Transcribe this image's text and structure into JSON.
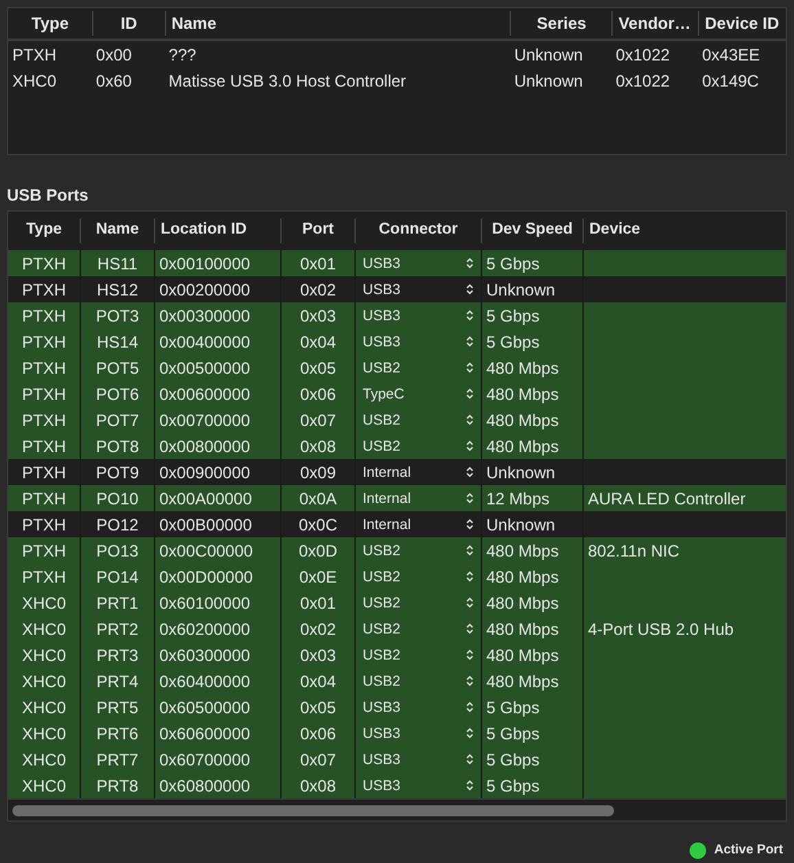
{
  "controllers": {
    "columns": [
      "Type",
      "ID",
      "Name",
      "Series",
      "Vendor…",
      "Device ID"
    ],
    "rows": [
      [
        "PTXH",
        "0x00",
        "???",
        "Unknown",
        "0x1022",
        "0x43EE"
      ],
      [
        "XHC0",
        "0x60",
        "Matisse USB 3.0 Host Controller",
        "Unknown",
        "0x1022",
        "0x149C"
      ]
    ]
  },
  "usb_ports": {
    "title": "USB Ports",
    "columns": [
      "Type",
      "Name",
      "Location ID",
      "Port",
      "Connector",
      "Dev Speed",
      "Device"
    ],
    "rows": [
      {
        "type": "PTXH",
        "name": "HS11",
        "location": "0x00100000",
        "port": "0x01",
        "connector": "USB3",
        "speed": "5 Gbps",
        "device": "",
        "active": true
      },
      {
        "type": "PTXH",
        "name": "HS12",
        "location": "0x00200000",
        "port": "0x02",
        "connector": "USB3",
        "speed": "Unknown",
        "device": "",
        "active": false
      },
      {
        "type": "PTXH",
        "name": "POT3",
        "location": "0x00300000",
        "port": "0x03",
        "connector": "USB3",
        "speed": "5 Gbps",
        "device": "",
        "active": true
      },
      {
        "type": "PTXH",
        "name": "HS14",
        "location": "0x00400000",
        "port": "0x04",
        "connector": "USB3",
        "speed": "5 Gbps",
        "device": "",
        "active": true
      },
      {
        "type": "PTXH",
        "name": "POT5",
        "location": "0x00500000",
        "port": "0x05",
        "connector": "USB2",
        "speed": "480 Mbps",
        "device": "",
        "active": true
      },
      {
        "type": "PTXH",
        "name": "POT6",
        "location": "0x00600000",
        "port": "0x06",
        "connector": "TypeC",
        "speed": "480 Mbps",
        "device": "",
        "active": true
      },
      {
        "type": "PTXH",
        "name": "POT7",
        "location": "0x00700000",
        "port": "0x07",
        "connector": "USB2",
        "speed": "480 Mbps",
        "device": "",
        "active": true
      },
      {
        "type": "PTXH",
        "name": "POT8",
        "location": "0x00800000",
        "port": "0x08",
        "connector": "USB2",
        "speed": "480 Mbps",
        "device": "",
        "active": true
      },
      {
        "type": "PTXH",
        "name": "POT9",
        "location": "0x00900000",
        "port": "0x09",
        "connector": "Internal",
        "speed": "Unknown",
        "device": "",
        "active": false
      },
      {
        "type": "PTXH",
        "name": "PO10",
        "location": "0x00A00000",
        "port": "0x0A",
        "connector": "Internal",
        "speed": "12 Mbps",
        "device": "AURA LED Controller",
        "active": true
      },
      {
        "type": "PTXH",
        "name": "PO12",
        "location": "0x00B00000",
        "port": "0x0C",
        "connector": "Internal",
        "speed": "Unknown",
        "device": "",
        "active": false
      },
      {
        "type": "PTXH",
        "name": "PO13",
        "location": "0x00C00000",
        "port": "0x0D",
        "connector": "USB2",
        "speed": "480 Mbps",
        "device": "802.11n NIC",
        "active": true
      },
      {
        "type": "PTXH",
        "name": "PO14",
        "location": "0x00D00000",
        "port": "0x0E",
        "connector": "USB2",
        "speed": "480 Mbps",
        "device": "",
        "active": true
      },
      {
        "type": "XHC0",
        "name": "PRT1",
        "location": "0x60100000",
        "port": "0x01",
        "connector": "USB2",
        "speed": "480 Mbps",
        "device": "",
        "active": true
      },
      {
        "type": "XHC0",
        "name": "PRT2",
        "location": "0x60200000",
        "port": "0x02",
        "connector": "USB2",
        "speed": "480 Mbps",
        "device": "4-Port USB 2.0 Hub",
        "active": true
      },
      {
        "type": "XHC0",
        "name": "PRT3",
        "location": "0x60300000",
        "port": "0x03",
        "connector": "USB2",
        "speed": "480 Mbps",
        "device": "",
        "active": true
      },
      {
        "type": "XHC0",
        "name": "PRT4",
        "location": "0x60400000",
        "port": "0x04",
        "connector": "USB2",
        "speed": "480 Mbps",
        "device": "",
        "active": true
      },
      {
        "type": "XHC0",
        "name": "PRT5",
        "location": "0x60500000",
        "port": "0x05",
        "connector": "USB3",
        "speed": "5 Gbps",
        "device": "",
        "active": true
      },
      {
        "type": "XHC0",
        "name": "PRT6",
        "location": "0x60600000",
        "port": "0x06",
        "connector": "USB3",
        "speed": "5 Gbps",
        "device": "",
        "active": true
      },
      {
        "type": "XHC0",
        "name": "PRT7",
        "location": "0x60700000",
        "port": "0x07",
        "connector": "USB3",
        "speed": "5 Gbps",
        "device": "",
        "active": true
      },
      {
        "type": "XHC0",
        "name": "PRT8",
        "location": "0x60800000",
        "port": "0x08",
        "connector": "USB3",
        "speed": "5 Gbps",
        "device": "",
        "active": true
      }
    ]
  },
  "legend": {
    "label": "Active Port",
    "color": "#2ecc40"
  }
}
